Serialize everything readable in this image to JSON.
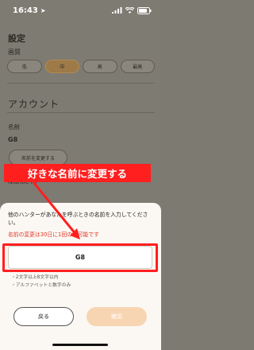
{
  "status_bar": {
    "time": "16:43",
    "location_arrow": "location-arrow-icon",
    "icons": [
      "signal-icon",
      "wifi-icon",
      "battery-icon"
    ]
  },
  "settings": {
    "title": "設定",
    "quality_label": "画質",
    "quality_options": [
      "低",
      "中",
      "高",
      "最高"
    ],
    "quality_selected": "中",
    "account_heading": "アカウント",
    "name_label": "名前",
    "name_value": "G8",
    "change_name_button": "名前を変更する",
    "niantic_id_label": "Niantic ID"
  },
  "dialog": {
    "message": "他のハンターがあなたを呼ぶときの名前を入力してください。",
    "warning": "名前の変更は30日に1回のみ可能です",
    "input_value": "G8",
    "rules": [
      "・2文字以上8文字以内",
      "・アルファベットと数字のみ"
    ],
    "cancel_button": "戻る",
    "confirm_button": "確認"
  },
  "annotation": {
    "caption": "好きな名前に変更する",
    "color": "#ff1f1f"
  },
  "colors": {
    "accent": "#9d7a48",
    "warning": "#e33629",
    "confirm_disabled": "#f7d5b2"
  }
}
